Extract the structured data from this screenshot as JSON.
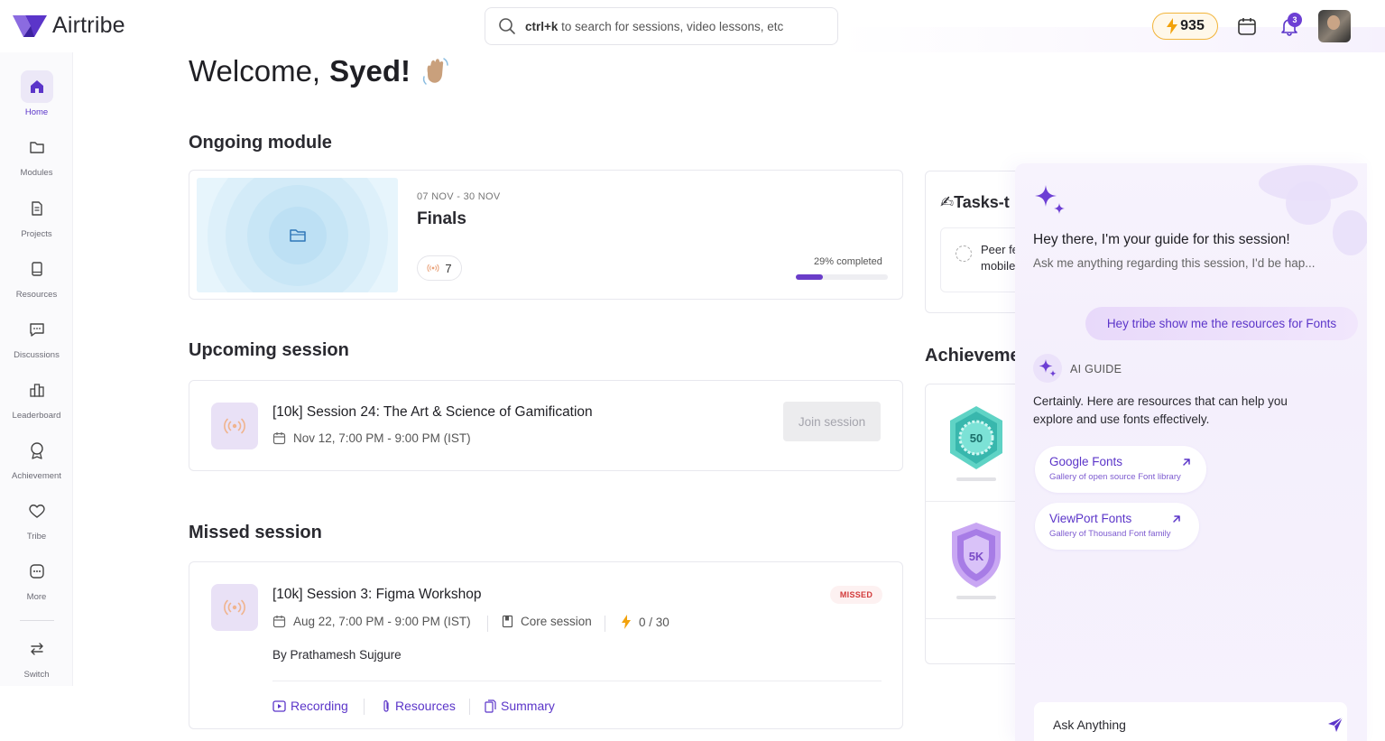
{
  "app": {
    "name": "Airtribe"
  },
  "search": {
    "shortcut": "ctrl+k",
    "hint": "to search for sessions, video lessons, etc"
  },
  "header": {
    "points": "935",
    "notifications": "3"
  },
  "sidebar": {
    "items": [
      {
        "label": "Home",
        "icon": "home-icon"
      },
      {
        "label": "Modules",
        "icon": "folder-icon"
      },
      {
        "label": "Projects",
        "icon": "document-icon"
      },
      {
        "label": "Resources",
        "icon": "book-icon"
      },
      {
        "label": "Discussions",
        "icon": "chat-icon"
      },
      {
        "label": "Leaderboard",
        "icon": "leaderboard-icon"
      },
      {
        "label": "Achievement",
        "icon": "award-icon"
      },
      {
        "label": "Tribe",
        "icon": "heart-icon"
      },
      {
        "label": "More",
        "icon": "more-icon"
      },
      {
        "label": "Switch",
        "icon": "switch-icon"
      }
    ]
  },
  "welcome": {
    "greeting": "Welcome,",
    "name": "Syed!"
  },
  "ongoing": {
    "title": "Ongoing module",
    "date": "07 NOV - 30 NOV",
    "name": "Finals",
    "live_count": "7",
    "progress_label": "29% completed",
    "progress": 0.29
  },
  "upcoming": {
    "title": "Upcoming session",
    "session_title": "[10k] Session 24: The Art & Science of Gamification",
    "datetime": "Nov 12, 7:00 PM - 9:00 PM (IST)",
    "join_label": "Join session"
  },
  "missed": {
    "title": "Missed session",
    "session_title": "[10k] Session 3: Figma Workshop",
    "badge": "MISSED",
    "datetime": "Aug 22, 7:00 PM - 9:00 PM (IST)",
    "type": "Core session",
    "points": "0 / 30",
    "by_prefix": "By",
    "author": "Prathamesh Sujgure",
    "links": {
      "recording": "Recording",
      "resources": "Resources",
      "summary": "Summary"
    }
  },
  "tasks": {
    "title": "Tasks-t",
    "item_line1": "Peer fe",
    "item_line2": "mobile"
  },
  "achievements": {
    "title": "Achieveme",
    "badges": [
      "50",
      "5K"
    ]
  },
  "ai_panel": {
    "hello": "Hey there, I'm your guide for this session!",
    "sub": "Ask me anything regarding this session, I'd be hap...",
    "user_message": "Hey tribe show me the resources for Fonts",
    "ai_label": "AI GUIDE",
    "ai_message": "Certainly. Here are resources that can help you explore and use fonts effectively.",
    "resources": [
      {
        "title": "Google Fonts",
        "sub": "Gallery of open source Font library"
      },
      {
        "title": "ViewPort Fonts",
        "sub": "Gallery of Thousand Font family"
      }
    ],
    "input_placeholder": "Ask Anything"
  },
  "colors": {
    "accent": "#5b35c9",
    "points_border": "#f2b43a",
    "missed": "#d23a3a"
  }
}
